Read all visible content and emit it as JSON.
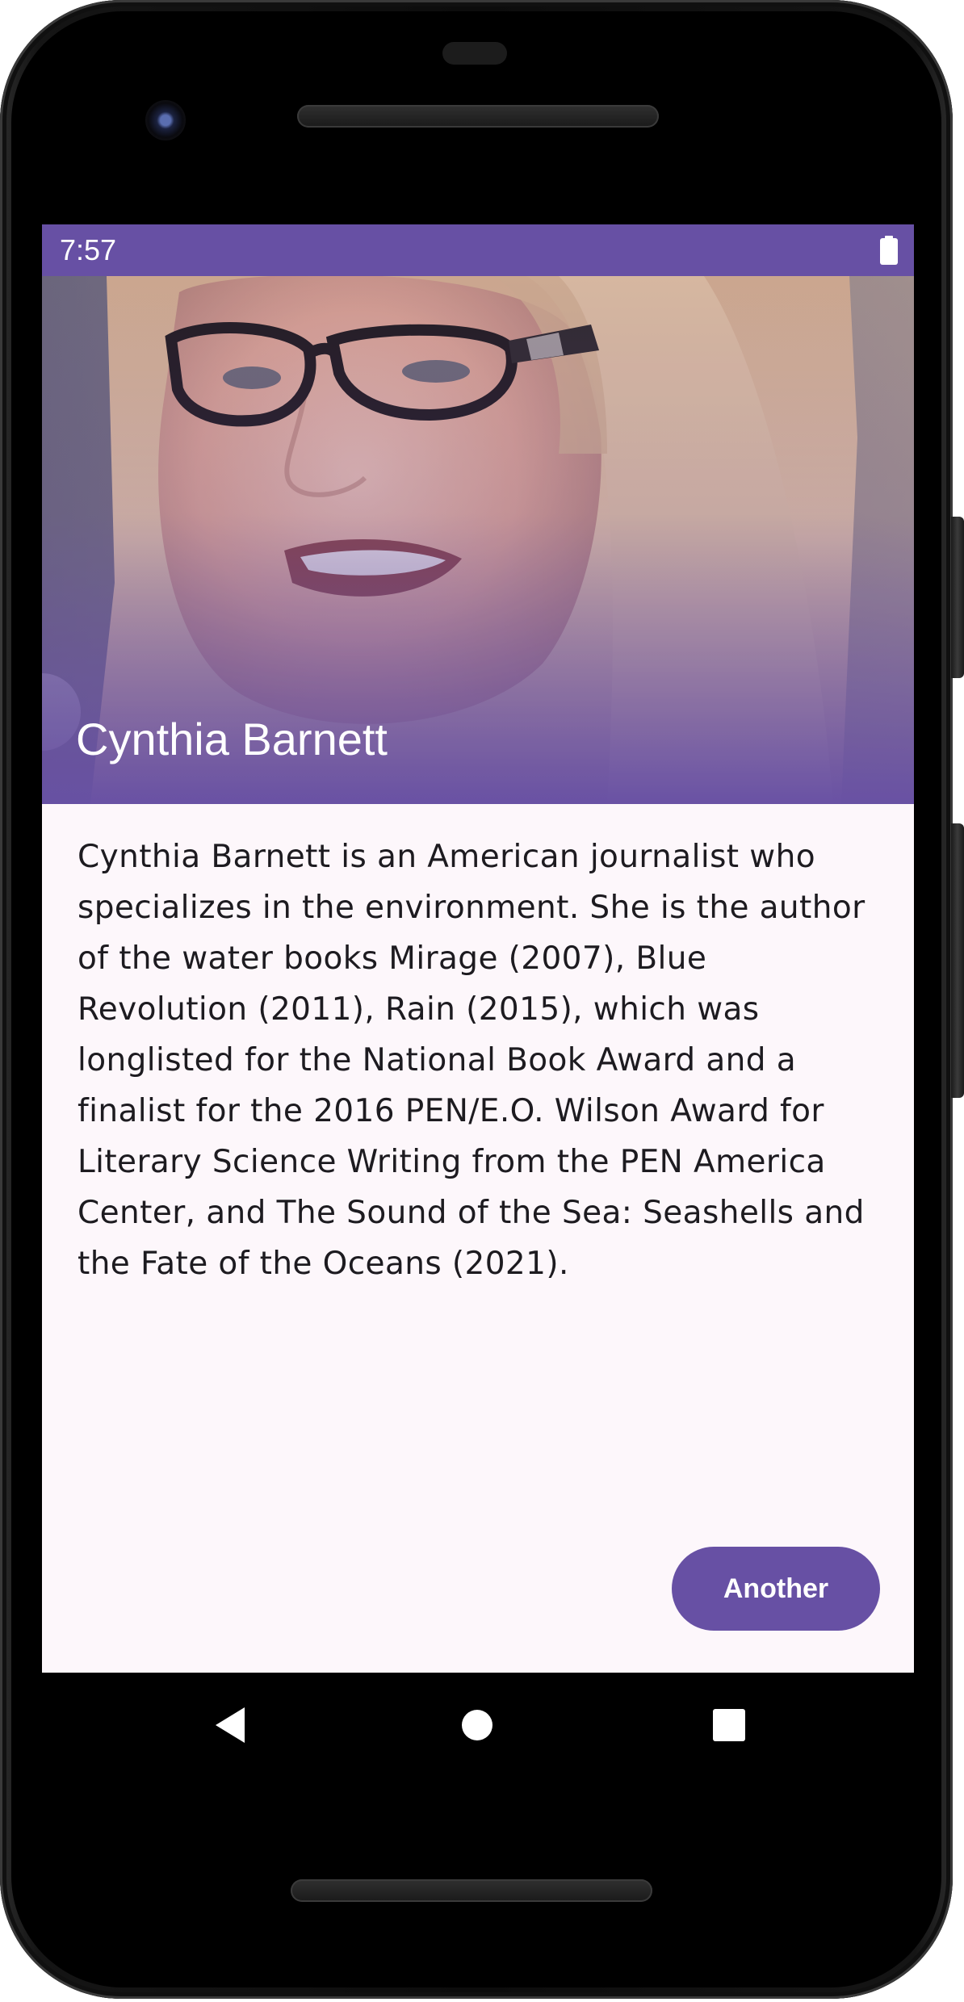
{
  "status_bar": {
    "time": "7:57",
    "battery_icon": "battery-full-icon"
  },
  "hero": {
    "name": "Cynthia Barnett",
    "image": "author-portrait-photo"
  },
  "bio": {
    "text": "Cynthia Barnett is an American journalist who specializes in the environment. She is the author of the water books Mirage (2007), Blue Revolution (2011), Rain (2015), which was longlisted for the National Book Award and a finalist for the 2016 PEN/E.O. Wilson Award for Literary Science Writing from the PEN America Center, and The Sound of the Sea: Seashells and the Fate of the Oceans (2021)."
  },
  "actions": {
    "another_label": "Another"
  },
  "nav_bar": {
    "back_icon": "back-triangle-icon",
    "home_icon": "home-circle-icon",
    "recents_icon": "recents-square-icon"
  },
  "colors": {
    "primary": "#6750a4",
    "background": "#fdf7fb",
    "text": "#1d1b20"
  }
}
